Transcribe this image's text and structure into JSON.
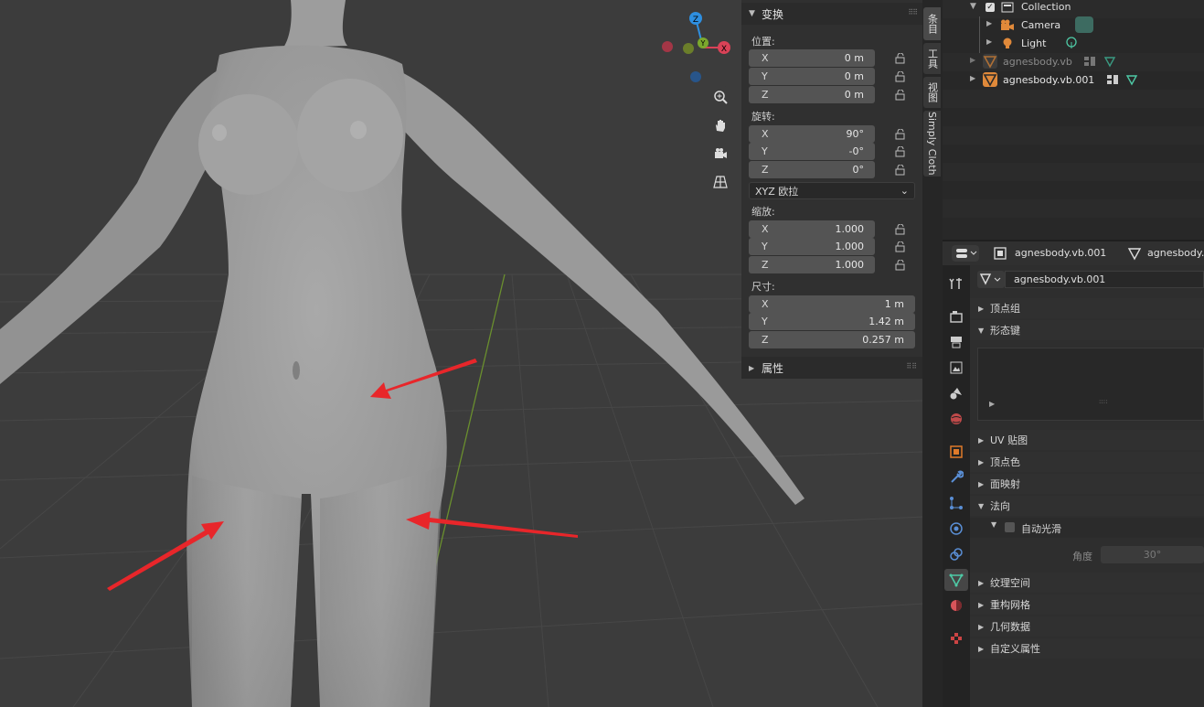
{
  "viewport": {
    "gizmo": {
      "z": "Z",
      "y": "Y",
      "x": "X"
    }
  },
  "npanel": {
    "transform": {
      "title": "变换",
      "location_label": "位置:",
      "location": [
        {
          "axis": "X",
          "value": "0 m"
        },
        {
          "axis": "Y",
          "value": "0 m"
        },
        {
          "axis": "Z",
          "value": "0 m"
        }
      ],
      "rotation_label": "旋转:",
      "rotation": [
        {
          "axis": "X",
          "value": "90°"
        },
        {
          "axis": "Y",
          "value": "-0°"
        },
        {
          "axis": "Z",
          "value": "0°"
        }
      ],
      "rotation_mode": "XYZ 欧拉",
      "scale_label": "缩放:",
      "scale": [
        {
          "axis": "X",
          "value": "1.000"
        },
        {
          "axis": "Y",
          "value": "1.000"
        },
        {
          "axis": "Z",
          "value": "1.000"
        }
      ],
      "dimensions_label": "尺寸:",
      "dimensions": [
        {
          "axis": "X",
          "value": "1 m"
        },
        {
          "axis": "Y",
          "value": "1.42 m"
        },
        {
          "axis": "Z",
          "value": "0.257 m"
        }
      ]
    },
    "properties_title": "属性"
  },
  "sidebar_tabs": [
    "条目",
    "工具",
    "视图",
    "Simply Cloth"
  ],
  "outliner": {
    "rows": [
      {
        "label": "Collection"
      },
      {
        "label": "Camera"
      },
      {
        "label": "Light"
      },
      {
        "label": "agnesbody.vb"
      },
      {
        "label": "agnesbody.vb.001"
      }
    ]
  },
  "properties": {
    "header": {
      "object": "agnesbody.vb.001",
      "data": "agnesbody.vb"
    },
    "mesh_name": "agnesbody.vb.001",
    "sections": {
      "vertex_groups": "顶点组",
      "shape_keys": "形态键",
      "uv_maps": "UV 贴图",
      "vertex_colors": "顶点色",
      "face_maps": "面映射",
      "normals": "法向",
      "auto_smooth": "自动光滑",
      "angle_label": "角度",
      "angle_value": "30°",
      "texture_space": "纹理空间",
      "remesh": "重构网格",
      "geometry_data": "几何数据",
      "custom_props": "自定义属性"
    }
  },
  "colors": {
    "arrow": "#e8262a",
    "mesh_active": "#4ec9a5",
    "object_orange": "#e07a2a",
    "axis_x": "#d94257",
    "axis_y": "#7ba82d",
    "axis_z": "#2e8fe0"
  }
}
